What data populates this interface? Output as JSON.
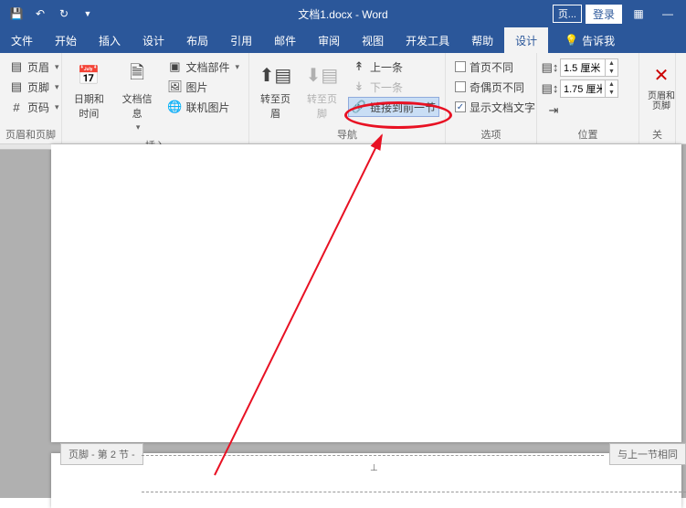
{
  "titlebar": {
    "doc_title": "文档1.docx - Word",
    "page_badge": "页...",
    "login": "登录"
  },
  "tabs": {
    "file": "文件",
    "home": "开始",
    "insert": "插入",
    "design": "设计",
    "layout": "布局",
    "references": "引用",
    "mailings": "邮件",
    "review": "审阅",
    "view": "视图",
    "developer": "开发工具",
    "help": "帮助",
    "active": "设计",
    "tellme": "告诉我"
  },
  "ribbon": {
    "hf_group": "页眉和页脚",
    "header": "页眉",
    "footer": "页脚",
    "pagenum": "页码",
    "insert_group": "插入",
    "datetime": "日期和时间",
    "docinfo": "文档信息",
    "quickparts": "文档部件",
    "pictures": "图片",
    "online_pics": "联机图片",
    "nav_group": "导航",
    "goto_header": "转至页眉",
    "goto_footer": "转至页脚",
    "prev": "上一条",
    "next": "下一条",
    "link_prev": "链接到前一节",
    "options_group": "选项",
    "first_diff": "首页不同",
    "oddeven_diff": "奇偶页不同",
    "show_text": "显示文档文字",
    "position_group": "位置",
    "header_from_top": "1.5 厘米",
    "footer_from_bottom": "1.75 厘米",
    "close_group_prefix": "关",
    "close_label": "页眉和页脚"
  },
  "doc": {
    "footer_section": "页脚 - 第 2 节 -",
    "same_as_prev": "与上一节相同"
  }
}
